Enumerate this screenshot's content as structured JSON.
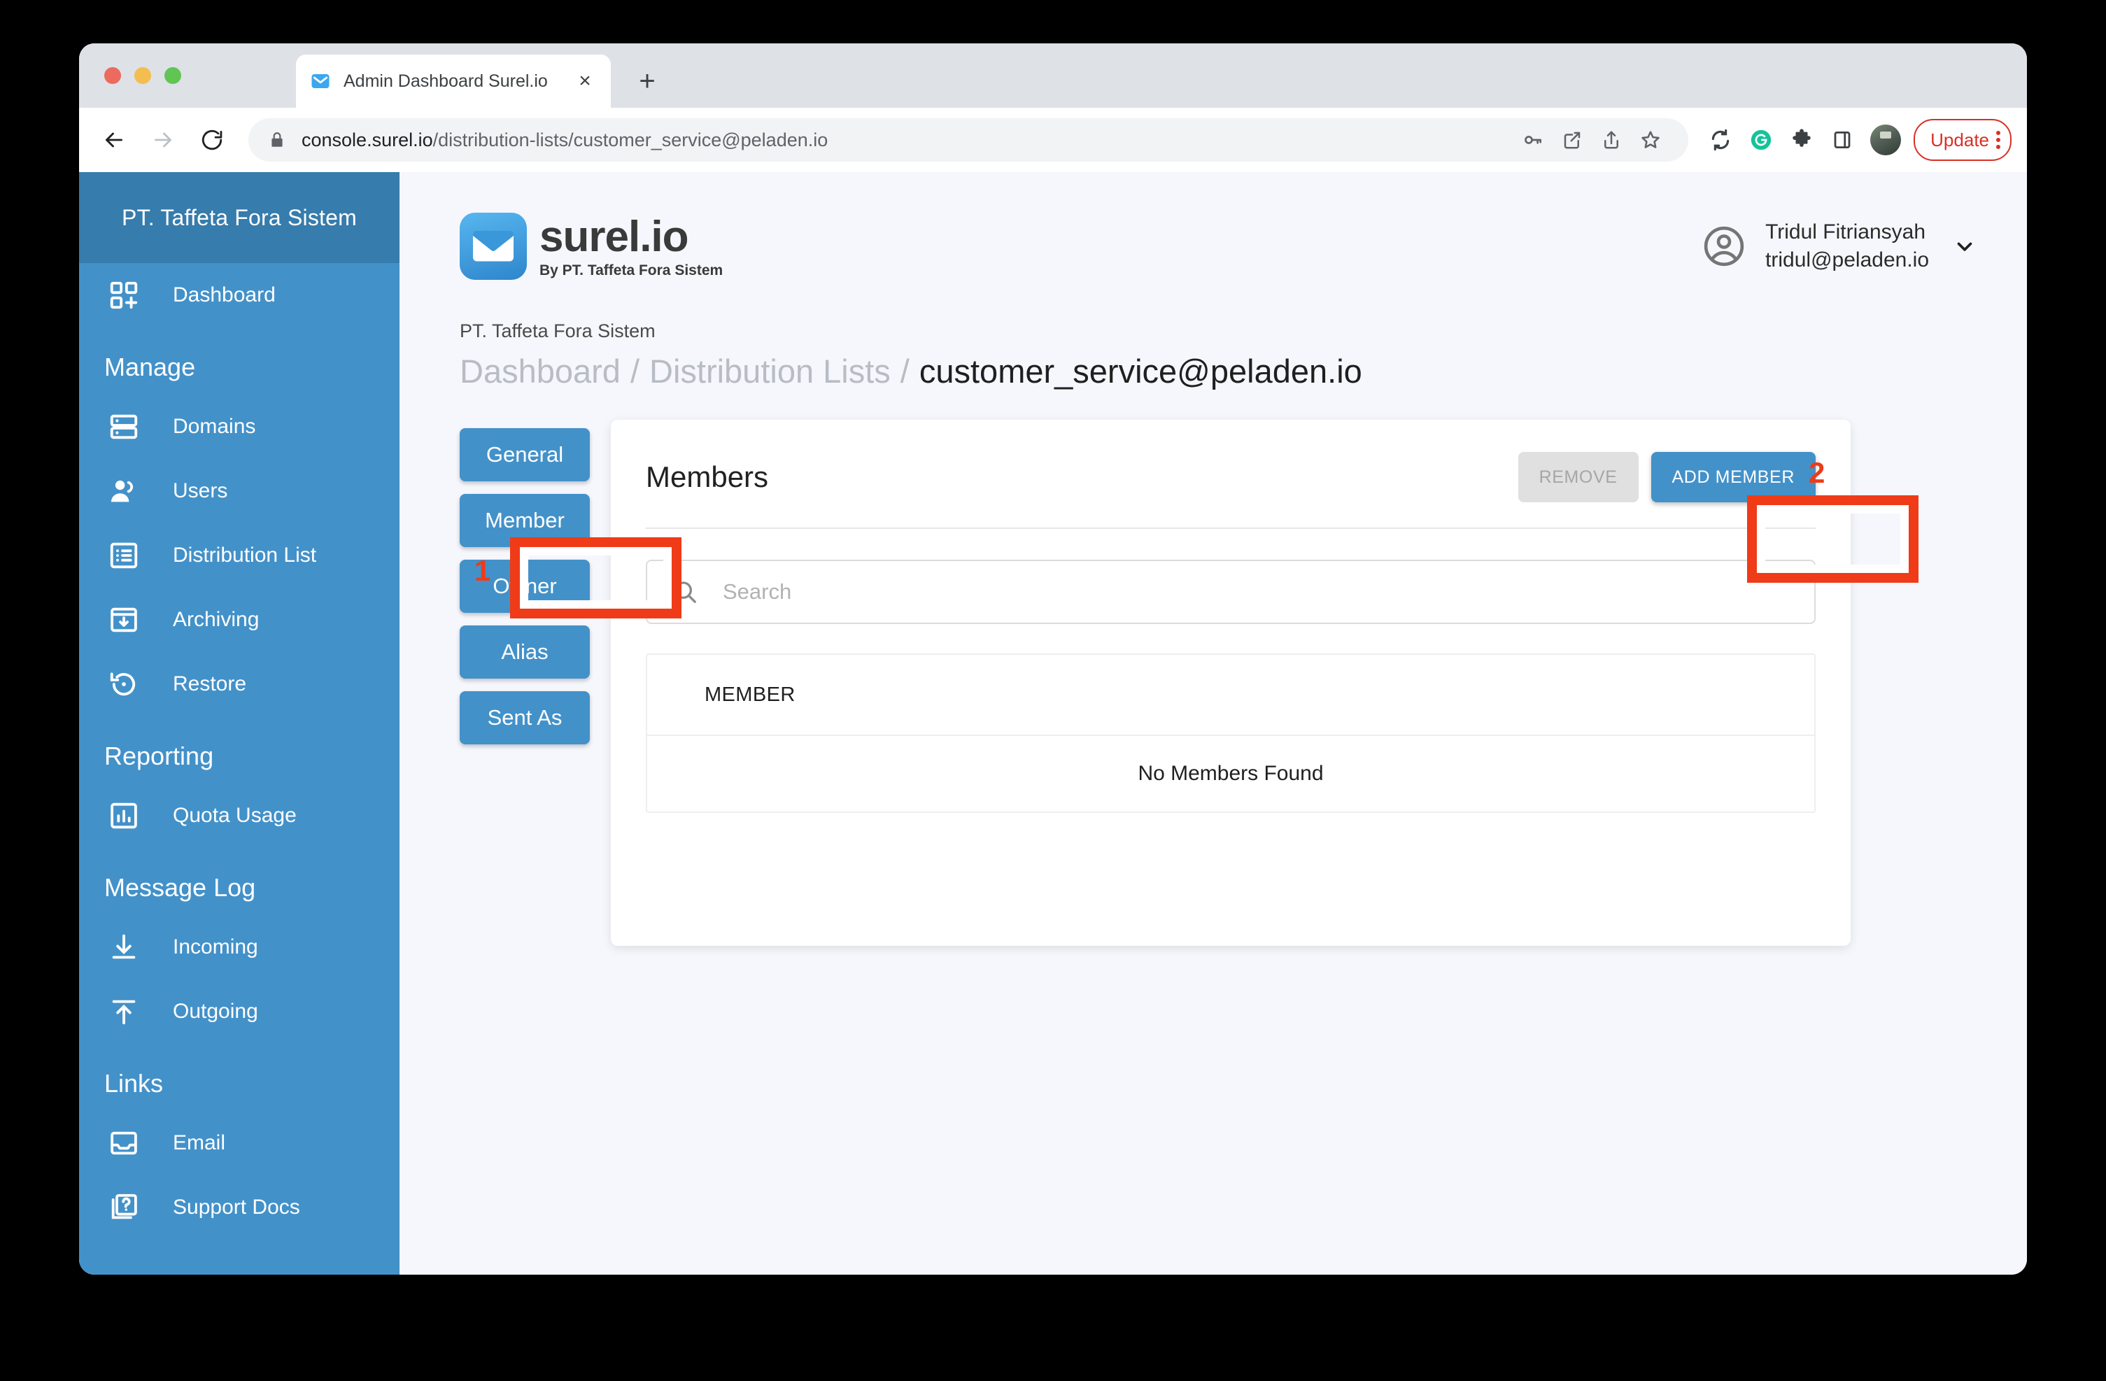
{
  "browser": {
    "tab": {
      "title": "Admin Dashboard Surel.io",
      "favicon": "mail-envelope-icon",
      "close": "×"
    },
    "new_tab": "+",
    "nav": {
      "back": "←",
      "forward": "→",
      "reload": "⟳"
    },
    "address": {
      "lock": "lock-icon",
      "host": "console.surel.io",
      "path": "/distribution-lists/customer_service@peladen.io"
    },
    "omnibox_icons": [
      "password-key-icon",
      "open-in-new-icon",
      "share-icon",
      "bookmark-star-icon"
    ],
    "extension_icons": [
      "sync-refresh-icon",
      "grammarly-icon",
      "puzzle-extension-icon",
      "sidepanel-icon"
    ],
    "profile_avatar": "profile-photo-avatar",
    "update_label": "Update",
    "menu": "kebab-menu-icon"
  },
  "sidebar": {
    "org": "PT. Taffeta Fora Sistem",
    "groups": [
      {
        "title": null,
        "items": [
          {
            "label": "Dashboard",
            "icon": "dashboard-grid-icon"
          }
        ]
      },
      {
        "title": "Manage",
        "items": [
          {
            "label": "Domains",
            "icon": "server-stack-icon"
          },
          {
            "label": "Users",
            "icon": "people-icon"
          },
          {
            "label": "Distribution List",
            "icon": "list-box-icon"
          },
          {
            "label": "Archiving",
            "icon": "archive-download-icon"
          },
          {
            "label": "Restore",
            "icon": "restore-clock-icon"
          }
        ]
      },
      {
        "title": "Reporting",
        "items": [
          {
            "label": "Quota Usage",
            "icon": "bar-chart-icon"
          }
        ]
      },
      {
        "title": "Message Log",
        "items": [
          {
            "label": "Incoming",
            "icon": "arrow-down-line-icon"
          },
          {
            "label": "Outgoing",
            "icon": "arrow-up-line-icon"
          }
        ]
      },
      {
        "title": "Links",
        "items": [
          {
            "label": "Email",
            "icon": "inbox-icon"
          },
          {
            "label": "Support Docs",
            "icon": "document-question-icon"
          }
        ]
      }
    ]
  },
  "header": {
    "brand_name": "surel.io",
    "brand_sub": "By PT. Taffeta Fora Sistem",
    "brand_logo": "envelope-logo-icon",
    "user": {
      "avatar": "account-circle-icon",
      "name": "Tridul Fitriansyah",
      "email": "tridul@peladen.io",
      "caret": "chevron-down-icon"
    }
  },
  "breadcrumb": {
    "org": "PT. Taffeta Fora Sistem",
    "items": [
      "Dashboard",
      "Distribution Lists"
    ],
    "separator": "/",
    "current": "customer_service@peladen.io"
  },
  "vertical_tabs": [
    {
      "label": "General"
    },
    {
      "label": "Member"
    },
    {
      "label": "Owner"
    },
    {
      "label": "Alias"
    },
    {
      "label": "Sent As"
    }
  ],
  "members_card": {
    "title": "Members",
    "remove_label": "REMOVE",
    "add_label": "ADD MEMBER",
    "search_placeholder": "Search",
    "search_value": "",
    "search_icon": "search-icon",
    "table": {
      "columns": [
        "MEMBER"
      ],
      "rows": [],
      "empty_message": "No Members Found"
    }
  },
  "annotations": [
    {
      "number": "1",
      "target": "Member"
    },
    {
      "number": "2",
      "target": "ADD MEMBER"
    }
  ],
  "colors": {
    "sidebar_body": "#4391c9",
    "sidebar_header": "#367cac",
    "page_bg": "#f5f7fc",
    "primary": "#4391c9",
    "annotation": "#ef3b18"
  }
}
